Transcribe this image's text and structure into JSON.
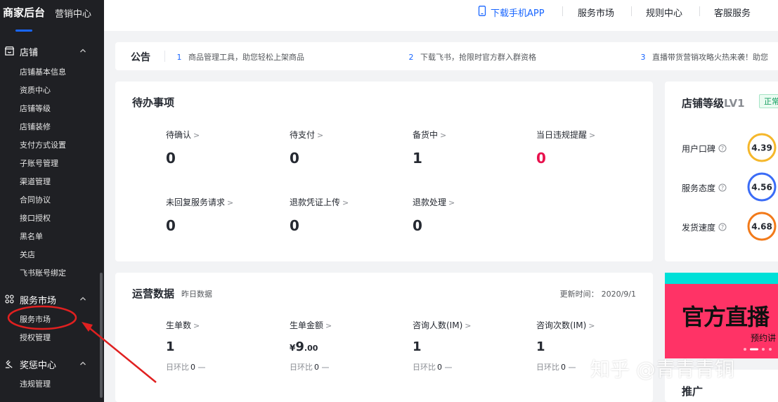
{
  "sidebar": {
    "title": "商家后台",
    "subtitle": "营销中心",
    "groups": [
      {
        "label": "店铺",
        "icon": "store-icon",
        "items": [
          "店铺基本信息",
          "资质中心",
          "店铺等级",
          "店铺装修",
          "支付方式设置",
          "子账号管理",
          "渠道管理",
          "合同协议",
          "接口授权",
          "黑名单",
          "关店",
          "飞书账号绑定"
        ]
      },
      {
        "label": "服务市场",
        "icon": "apps-icon",
        "items": [
          "服务市场",
          "授权管理"
        ]
      },
      {
        "label": "奖惩中心",
        "icon": "gavel-icon",
        "items": [
          "违规管理"
        ]
      }
    ]
  },
  "topbar": {
    "links": [
      "下载手机APP",
      "服务市场",
      "规则中心",
      "客服服务"
    ]
  },
  "announcement": {
    "title": "公告",
    "items": [
      {
        "num": "1",
        "text": "商品管理工具，助您轻松上架商品"
      },
      {
        "num": "2",
        "text": "下载飞书，抢限时官方群入群资格"
      },
      {
        "num": "3",
        "text": "直播带货营销攻略火热来袭！助您"
      }
    ]
  },
  "todo": {
    "title": "待办事项",
    "cells": [
      {
        "label": "待确认",
        "value": "0"
      },
      {
        "label": "待支付",
        "value": "0"
      },
      {
        "label": "备货中",
        "value": "1"
      },
      {
        "label": "当日违规提醒",
        "value": "0"
      },
      {
        "label": "未回复服务请求",
        "value": "0"
      },
      {
        "label": "退款凭证上传",
        "value": "0"
      },
      {
        "label": "退款处理",
        "value": "0"
      }
    ],
    "alert_color": "#e8114d"
  },
  "ops": {
    "title": "运营数据",
    "subtitle": "昨日数据",
    "updated_label": "更新时间：",
    "updated_value": "2020/9/1",
    "compare_label": "日环比",
    "cells": [
      {
        "label": "生单数",
        "value": "1",
        "compare": "0"
      },
      {
        "label": "生单金额",
        "value_prefix": "¥",
        "value": "9",
        "value_suffix": ".00",
        "compare": "0"
      },
      {
        "label": "咨询人数(IM)",
        "value": "1",
        "compare": "0"
      },
      {
        "label": "咨询次数(IM)",
        "value": "1",
        "compare": "0"
      }
    ]
  },
  "level": {
    "title": "店铺等级",
    "level": "LV1",
    "badge": "正常",
    "metrics": [
      {
        "label": "用户口碑",
        "score": "4.39",
        "color": "#f5b72b"
      },
      {
        "label": "服务态度",
        "score": "4.56",
        "color": "#3b6cf6"
      },
      {
        "label": "发货速度",
        "score": "4.68",
        "color": "#f27a1a"
      }
    ]
  },
  "banner": {
    "text": "官方直播",
    "sub": "预约讲"
  },
  "promo": {
    "title": "推广"
  },
  "watermark": "知乎 @青青青铜",
  "colors": {
    "accent": "#1966ff",
    "sidebar_bg": "#1f2024",
    "page_bg": "#f2f3f5",
    "annotation": "#e02020"
  }
}
